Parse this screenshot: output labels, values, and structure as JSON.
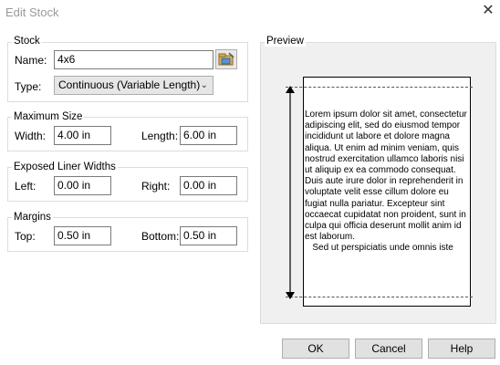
{
  "window": {
    "title": "Edit Stock",
    "close_glyph": "✕"
  },
  "stock": {
    "group_label": "Stock",
    "name_label": "Name:",
    "name_value": "4x6",
    "type_label": "Type:",
    "type_value": "Continuous (Variable Length)"
  },
  "max_size": {
    "group_label": "Maximum Size",
    "width_label": "Width:",
    "width_value": "4.00 in",
    "length_label": "Length:",
    "length_value": "6.00 in"
  },
  "liner": {
    "group_label": "Exposed Liner Widths",
    "left_label": "Left:",
    "left_value": "0.00 in",
    "right_label": "Right:",
    "right_value": "0.00 in"
  },
  "margins": {
    "group_label": "Margins",
    "top_label": "Top:",
    "top_value": "0.50 in",
    "bottom_label": "Bottom:",
    "bottom_value": "0.50 in"
  },
  "preview": {
    "group_label": "Preview",
    "text": "Lorem ipsum dolor sit amet, consectetur adipiscing elit, sed do eiusmod tempor incididunt ut labore et dolore magna aliqua. Ut enim ad minim veniam, quis nostrud exercitation ullamco laboris nisi ut aliquip ex ea commodo consequat. Duis aute irure dolor in reprehenderit in voluptate velit esse cillum dolore eu fugiat nulla pariatur. Excepteur sint occaecat cupidatat non proident, sunt in culpa qui officia deserunt mollit anim id est laborum.\n   Sed ut perspiciatis unde omnis iste"
  },
  "buttons": {
    "ok": "OK",
    "cancel": "Cancel",
    "help": "Help"
  }
}
